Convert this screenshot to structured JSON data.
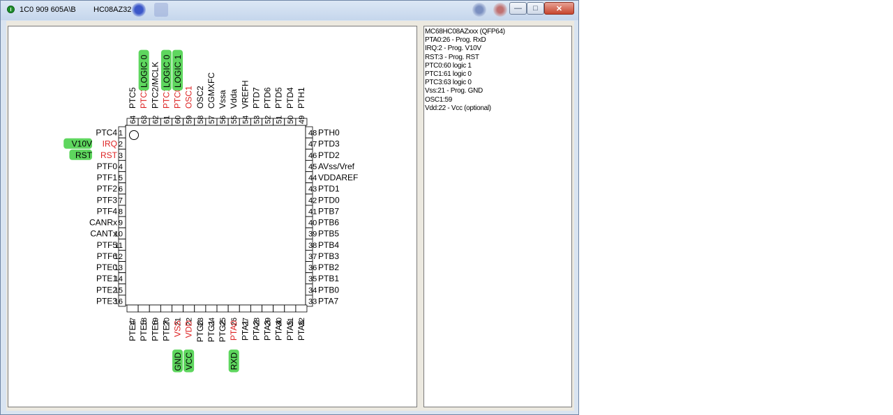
{
  "window": {
    "title_left": "1C0 909 605A\\B",
    "title_right": "HC08AZ32",
    "min_glyph": "—",
    "max_glyph": "□",
    "close_glyph": "✕"
  },
  "chip": {
    "left_pins": [
      {
        "num": "1",
        "label": "PTC4"
      },
      {
        "num": "2",
        "label": "IRQ",
        "red": true,
        "tag": "V10V"
      },
      {
        "num": "3",
        "label": "RST",
        "red": true,
        "tag": "RST"
      },
      {
        "num": "4",
        "label": "PTF0"
      },
      {
        "num": "5",
        "label": "PTF1"
      },
      {
        "num": "6",
        "label": "PTF2"
      },
      {
        "num": "7",
        "label": "PTF3"
      },
      {
        "num": "8",
        "label": "PTF4"
      },
      {
        "num": "9",
        "label": "CANRx"
      },
      {
        "num": "10",
        "label": "CANTx"
      },
      {
        "num": "11",
        "label": "PTF5"
      },
      {
        "num": "12",
        "label": "PTF6"
      },
      {
        "num": "13",
        "label": "PTE0"
      },
      {
        "num": "14",
        "label": "PTE1"
      },
      {
        "num": "15",
        "label": "PTE2"
      },
      {
        "num": "16",
        "label": "PTE3"
      }
    ],
    "right_pins": [
      {
        "num": "48",
        "label": "PTH0"
      },
      {
        "num": "47",
        "label": "PTD3"
      },
      {
        "num": "46",
        "label": "PTD2"
      },
      {
        "num": "45",
        "label": "AVss/Vref"
      },
      {
        "num": "44",
        "label": "VDDAREF"
      },
      {
        "num": "43",
        "label": "PTD1"
      },
      {
        "num": "42",
        "label": "PTD0"
      },
      {
        "num": "41",
        "label": "PTB7"
      },
      {
        "num": "40",
        "label": "PTB6"
      },
      {
        "num": "39",
        "label": "PTB5"
      },
      {
        "num": "38",
        "label": "PTB4"
      },
      {
        "num": "37",
        "label": "PTB3"
      },
      {
        "num": "36",
        "label": "PTB2"
      },
      {
        "num": "35",
        "label": "PTB1"
      },
      {
        "num": "34",
        "label": "PTB0"
      },
      {
        "num": "33",
        "label": "PTA7"
      }
    ],
    "bottom_pins": [
      {
        "num": "17",
        "label": "PTE4"
      },
      {
        "num": "18",
        "label": "PTE5"
      },
      {
        "num": "19",
        "label": "PTE6"
      },
      {
        "num": "20",
        "label": "PTE7"
      },
      {
        "num": "21",
        "label": "VSS",
        "red": true,
        "tag": "GND"
      },
      {
        "num": "22",
        "label": "VDD",
        "red": true,
        "tag": "VCC"
      },
      {
        "num": "23",
        "label": "PTG0"
      },
      {
        "num": "24",
        "label": "PTG1"
      },
      {
        "num": "25",
        "label": "PTG2"
      },
      {
        "num": "26",
        "label": "PTA0",
        "red": true,
        "tag": "RXD"
      },
      {
        "num": "27",
        "label": "PTA1"
      },
      {
        "num": "28",
        "label": "PTA2"
      },
      {
        "num": "29",
        "label": "PTA3"
      },
      {
        "num": "30",
        "label": "PTA4"
      },
      {
        "num": "31",
        "label": "PTA5"
      },
      {
        "num": "32",
        "label": "PTA6"
      }
    ],
    "top_pins": [
      {
        "num": "64",
        "label": "PTC5"
      },
      {
        "num": "63",
        "label": "PTC3",
        "red": true,
        "tag": "LOGIC 0"
      },
      {
        "num": "62",
        "label": "PTC2/MCLK"
      },
      {
        "num": "61",
        "label": "PTC1",
        "red": true,
        "tag": "LOGIC 0"
      },
      {
        "num": "60",
        "label": "PTC0",
        "red": true,
        "tag": "LOGIC 1"
      },
      {
        "num": "59",
        "label": "OSC1",
        "red": true
      },
      {
        "num": "58",
        "label": "OSC2"
      },
      {
        "num": "57",
        "label": "CGMXFC"
      },
      {
        "num": "56",
        "label": "Vssa"
      },
      {
        "num": "55",
        "label": "Vdda"
      },
      {
        "num": "54",
        "label": "VREFH"
      },
      {
        "num": "53",
        "label": "PTD7"
      },
      {
        "num": "52",
        "label": "PTD6"
      },
      {
        "num": "51",
        "label": "PTD5"
      },
      {
        "num": "50",
        "label": "PTD4"
      },
      {
        "num": "49",
        "label": "PTH1"
      }
    ]
  },
  "info": {
    "lines": [
      "MC68HC08AZxxx (QFP64)",
      "PTA0:26 - Prog. RxD",
      "IRQ:2 - Prog. V10V",
      "RST:3 - Prog. RST",
      "PTC0:60 logic 1",
      "PTC1:61 logic 0",
      "PTC3:63 logic 0",
      "Vss:21 - Prog. GND",
      "OSC1:59",
      "Vdd:22 - Vcc (optional)"
    ]
  },
  "colors": {
    "tag_green": "#5ed65e",
    "pin_red": "#dd2222",
    "pin_black": "#000000"
  }
}
